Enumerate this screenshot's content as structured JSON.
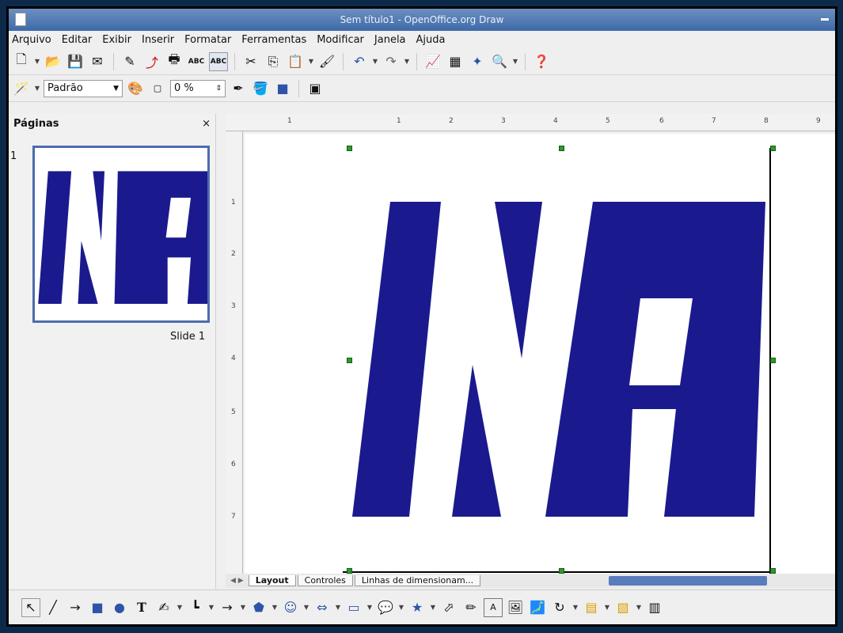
{
  "window": {
    "title": "Sem título1 - OpenOffice.org Draw"
  },
  "menu": [
    "Arquivo",
    "Editar",
    "Exibir",
    "Inserir",
    "Formatar",
    "Ferramentas",
    "Modificar",
    "Janela",
    "Ajuda"
  ],
  "toolbar2": {
    "style_value": "Padrão",
    "transparency_value": "0 %"
  },
  "pages_panel": {
    "title": "Páginas",
    "close": "×",
    "thumb_number": "1",
    "slide_label": "Slide 1"
  },
  "ruler_top_numbers": [
    "1",
    "1",
    "2",
    "3",
    "4",
    "5",
    "6",
    "7",
    "8",
    "9"
  ],
  "ruler_left_numbers": [
    "1",
    "2",
    "3",
    "4",
    "5",
    "6",
    "7"
  ],
  "logo_text": "INPI",
  "tabs": [
    "Layout",
    "Controles",
    "Linhas de dimensionam..."
  ],
  "colors": {
    "logo_blue": "#1a1a8e",
    "title_blue": "#3e6aa8",
    "handle_green": "#2c9a2c",
    "scroll_blue": "#5a7cbd"
  }
}
